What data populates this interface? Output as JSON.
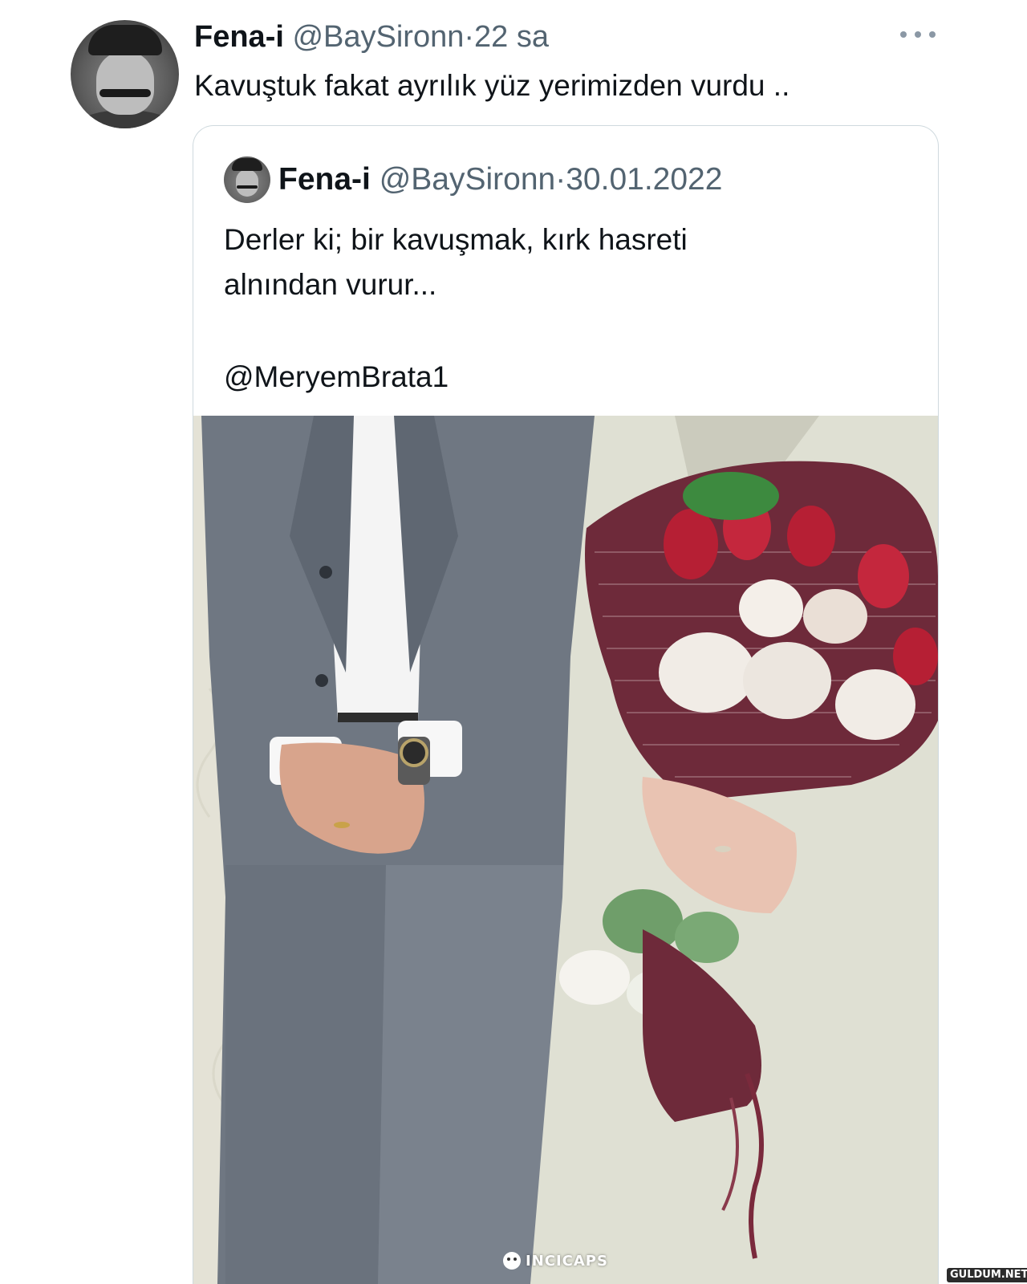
{
  "tweet": {
    "author_name": "Fena-i",
    "author_handle": "@BaySironn",
    "separator": "·",
    "time": "22 sa",
    "text": "Kavuştuk fakat ayrılık yüz yerimizden vurdu .."
  },
  "quoted_tweet": {
    "author_name": "Fena-i",
    "author_handle": "@BaySironn",
    "separator": "·",
    "date": "30.01.2022",
    "text": "Derler ki; bir kavuşmak, kırk hasreti\nalnından vurur...",
    "mention": "@MeryemBrata1",
    "media_description": "wedding-couple-photo"
  },
  "watermarks": {
    "left": "INCICAPS",
    "right": "GULDUM.NET"
  },
  "icons": {
    "more": "more-horizontal-icon"
  },
  "colors": {
    "text_primary": "#0f1419",
    "text_secondary": "#536471",
    "border": "#cfd9de"
  }
}
